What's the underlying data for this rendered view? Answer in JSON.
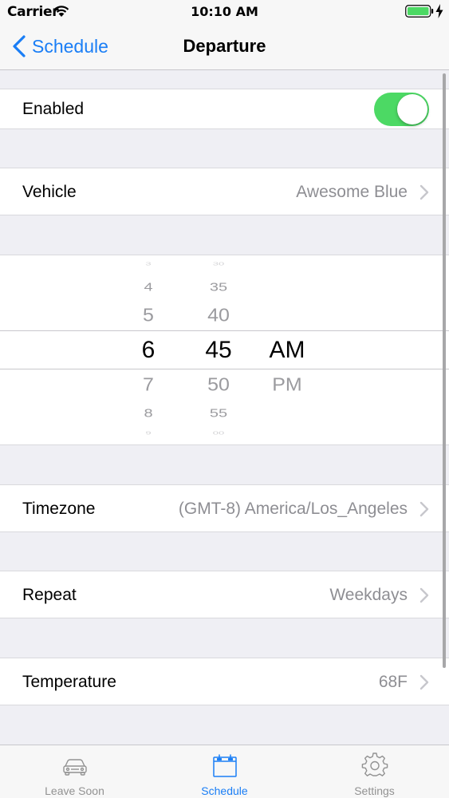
{
  "status_bar": {
    "carrier": "Carrier",
    "time": "10:10 AM",
    "battery_icon": "battery-icon",
    "signal_icon": "wifi-icon"
  },
  "nav": {
    "back_label": "Schedule",
    "title": "Departure"
  },
  "enabled": {
    "label": "Enabled",
    "toggle_on": true
  },
  "vehicle": {
    "label": "Vehicle",
    "value": "Awesome Blue"
  },
  "time_picker": {
    "hours": [
      "4",
      "5",
      "6",
      "7",
      "8"
    ],
    "minutes": [
      "35",
      "40",
      "45",
      "50",
      "55"
    ],
    "periods": [
      "AM",
      "PM"
    ],
    "selected_hour": "6",
    "selected_minute": "45",
    "selected_period": "AM"
  },
  "timezone": {
    "label": "Timezone",
    "value": "(GMT-8) America/Los_Angeles"
  },
  "repeat": {
    "label": "Repeat",
    "value": "Weekdays"
  },
  "temperature": {
    "label": "Temperature",
    "value": "68F"
  },
  "tab_bar": {
    "tabs": [
      {
        "label": "Leave Soon",
        "icon": "car-icon",
        "active": false
      },
      {
        "label": "Schedule",
        "icon": "calendar-icon",
        "active": true
      },
      {
        "label": "Settings",
        "icon": "gear-icon",
        "active": false
      }
    ]
  },
  "colors": {
    "accent": "#1a7ef6",
    "toggle_on": "#4cd964",
    "secondary_text": "#8e8e93",
    "background": "#efeff4"
  }
}
